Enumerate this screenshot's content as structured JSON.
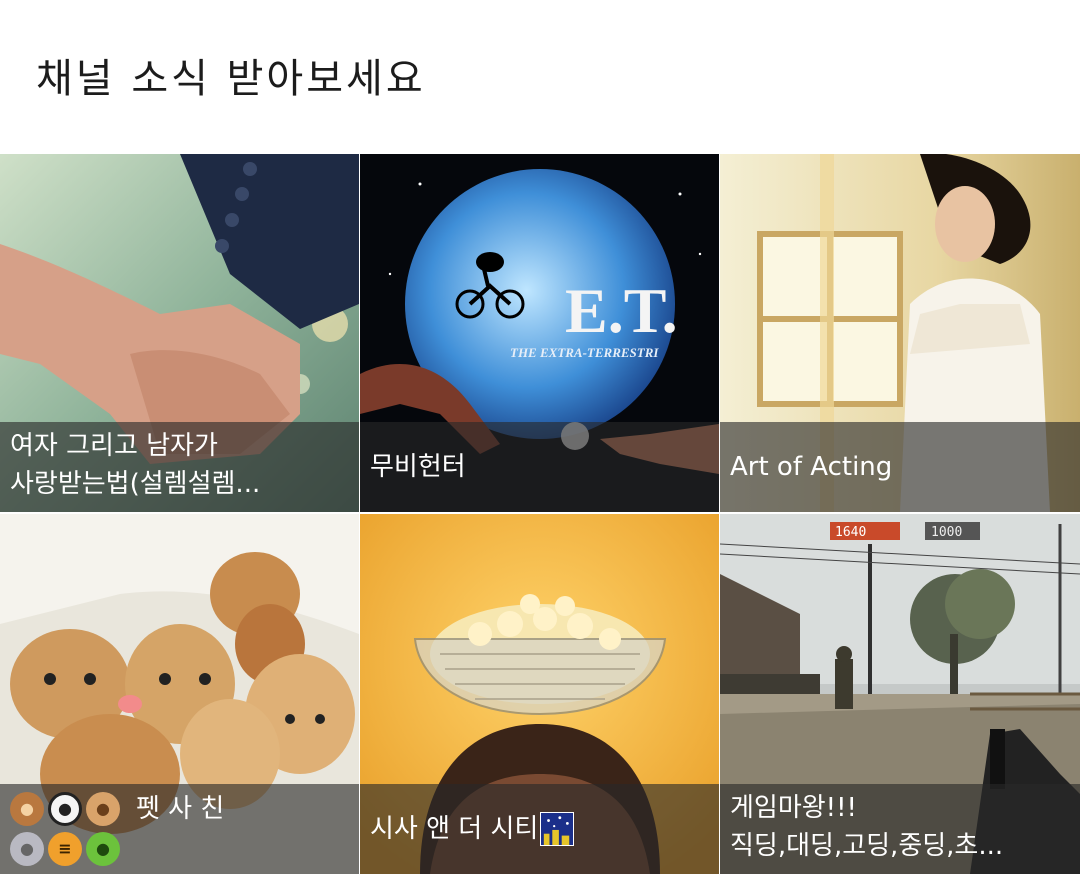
{
  "header": {
    "title": "채널 소식 받아보세요"
  },
  "channels": [
    {
      "lines": [
        "여자 그리고 남자가",
        "사랑받는법(설렘설렘..."
      ],
      "image": "holding-hands-photo"
    },
    {
      "lines": [
        "무비헌터"
      ],
      "image": "et-movie-poster",
      "poster_title": "E.T.",
      "poster_subtitle": "THE EXTRA-TERRESTRI"
    },
    {
      "lines": [
        "Art of Acting"
      ],
      "image": "woman-white-dress-photo"
    },
    {
      "lines": [
        "펫 사 친"
      ],
      "image": "puppies-photo",
      "emojis_row1": [
        "monkey-emoji",
        "panda-emoji",
        "dog-emoji"
      ],
      "emojis_row2": [
        "mouse-emoji",
        "tiger-emoji",
        "frog-emoji"
      ]
    },
    {
      "lines": [
        "시사 앤 더 시티"
      ],
      "image": "popcorn-bowl-photo",
      "trailing_icon": "night-city-icon"
    },
    {
      "lines": [
        "게임마왕!!!",
        "직딩,대딩,고딩,중딩,초..."
      ],
      "image": "fps-game-screenshot",
      "hud": [
        "1640",
        "1000"
      ]
    }
  ]
}
